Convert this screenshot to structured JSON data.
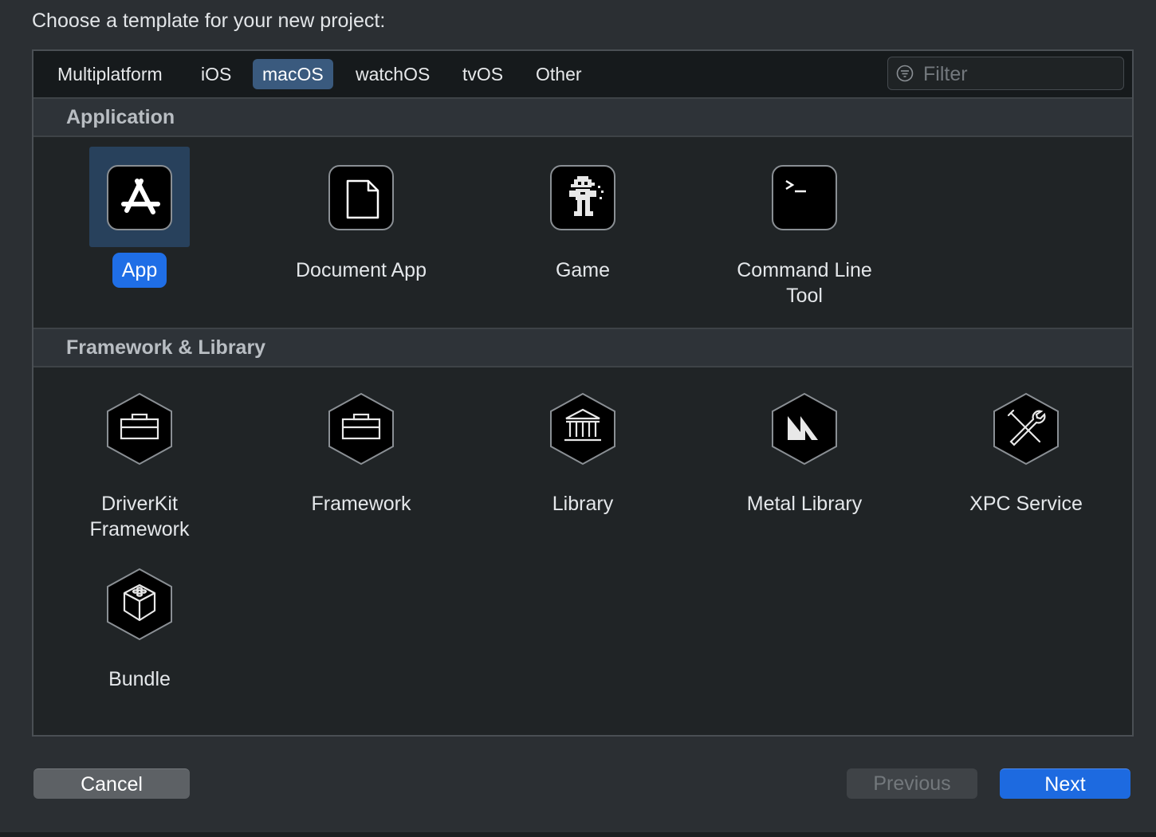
{
  "prompt": "Choose a template for your new project:",
  "tabs": [
    {
      "label": "Multiplatform",
      "active": false
    },
    {
      "label": "iOS",
      "active": false
    },
    {
      "label": "macOS",
      "active": true
    },
    {
      "label": "watchOS",
      "active": false
    },
    {
      "label": "tvOS",
      "active": false
    },
    {
      "label": "Other",
      "active": false
    }
  ],
  "filter": {
    "placeholder": "Filter",
    "value": "",
    "icon": "filter-icon"
  },
  "sections": [
    {
      "title": "Application",
      "items": [
        {
          "label": "App",
          "icon": "app-store-icon",
          "selected": true
        },
        {
          "label": "Document App",
          "icon": "document-icon",
          "selected": false
        },
        {
          "label": "Game",
          "icon": "game-sprite-icon",
          "selected": false
        },
        {
          "label": "Command Line Tool",
          "icon": "terminal-icon",
          "selected": false
        }
      ]
    },
    {
      "title": "Framework & Library",
      "items": [
        {
          "label": "DriverKit Framework",
          "icon": "toolbox-icon"
        },
        {
          "label": "Framework",
          "icon": "toolbox-icon"
        },
        {
          "label": "Library",
          "icon": "building-columns-icon"
        },
        {
          "label": "Metal Library",
          "icon": "metal-icon"
        },
        {
          "label": "XPC Service",
          "icon": "wrench-screwdriver-icon"
        },
        {
          "label": "Bundle",
          "icon": "cube-icon"
        }
      ]
    }
  ],
  "buttons": {
    "cancel": "Cancel",
    "previous": "Previous",
    "next": "Next"
  },
  "colors": {
    "accent": "#1d6ae0",
    "selection": "#28415c",
    "active_tab": "#3a5a7e"
  }
}
